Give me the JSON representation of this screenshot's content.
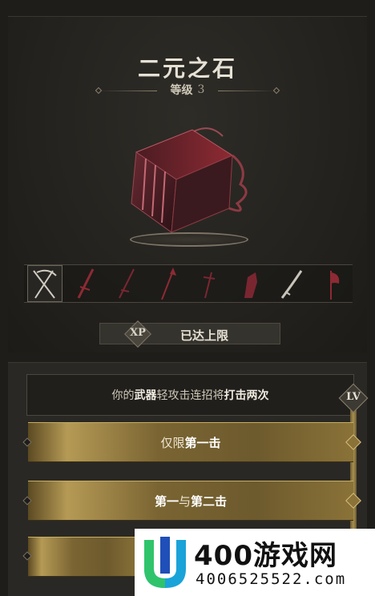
{
  "item": {
    "name": "二元之石",
    "level_label": "等级",
    "level_value": "3"
  },
  "weapons": [
    {
      "icon": "scythe-icon",
      "selected": true
    },
    {
      "icon": "sword-icon",
      "selected": false
    },
    {
      "icon": "sword-icon",
      "selected": false
    },
    {
      "icon": "spear-icon",
      "selected": false
    },
    {
      "icon": "dagger-icon",
      "selected": false
    },
    {
      "icon": "gauntlet-icon",
      "selected": false
    },
    {
      "icon": "katana-icon",
      "selected": false
    },
    {
      "icon": "axe-icon",
      "selected": false
    }
  ],
  "xp": {
    "badge": "XP",
    "status": "已达上限"
  },
  "upgrade": {
    "desc_parts": [
      "你的",
      "武器",
      "轻攻击连招将",
      "打击两次"
    ],
    "lv_badge": "LV",
    "tiers": [
      {
        "normal": "仅限",
        "highlight": "第一击",
        "tail": "",
        "mid": ""
      },
      {
        "normal": "",
        "highlight": "第一",
        "mid": "与",
        "tail": "第二击"
      },
      {
        "normal": "",
        "highlight": "",
        "mid": "",
        "tail": ""
      }
    ]
  },
  "watermark": {
    "name": "400游戏网",
    "phone": "4006525522.com"
  },
  "colors": {
    "gold": "#b59a55",
    "crimson": "#8e2a33",
    "background": "#1e1d1a"
  }
}
